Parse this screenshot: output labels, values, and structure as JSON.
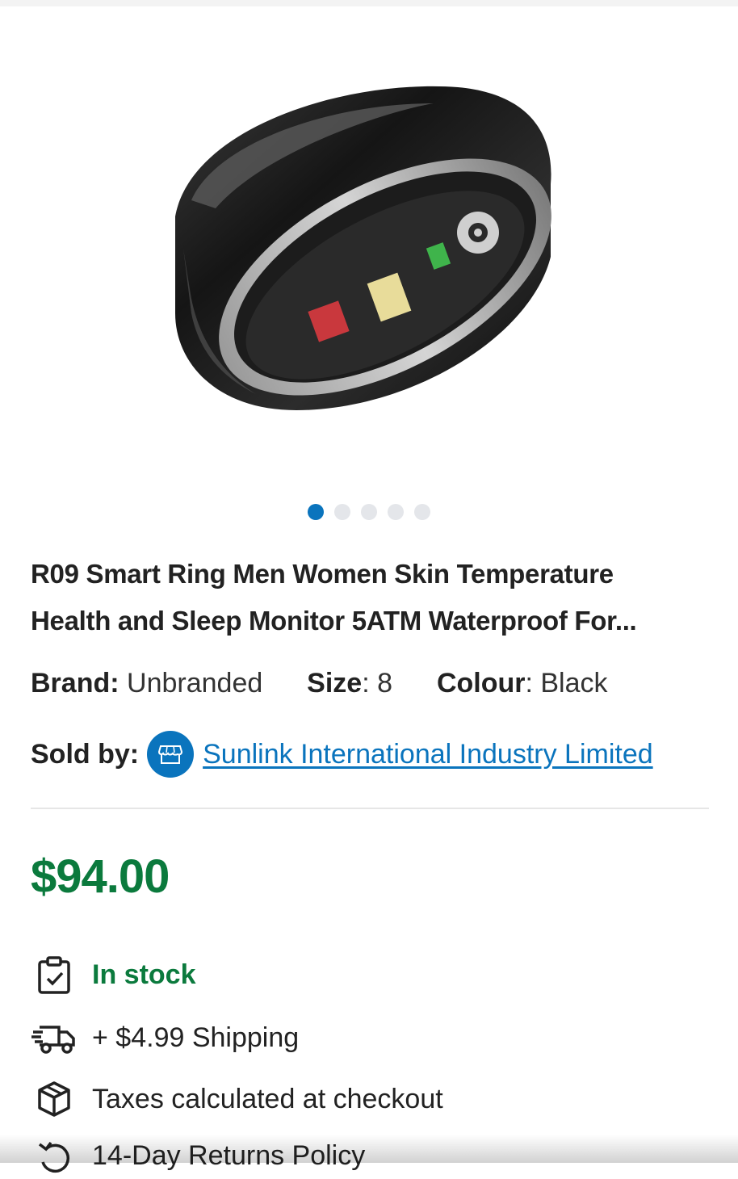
{
  "gallery": {
    "image_alt": "product-image",
    "dot_count": 5,
    "active_index": 0
  },
  "product": {
    "title_line1": "R09 Smart Ring Men Women Skin Temperature",
    "title_line2": "Health and Sleep Monitor 5ATM Waterproof For...",
    "brand_label": "Brand:",
    "brand_value": "Unbranded",
    "size_label": "Size",
    "size_value": ": 8",
    "colour_label": "Colour",
    "colour_value": ": Black",
    "sold_by_label": "Sold by:",
    "seller_name": "Sunlink International Industry Limited",
    "price": "$94.00",
    "stock_status": "In stock",
    "shipping": "+ $4.99 Shipping",
    "taxes": "Taxes calculated at checkout",
    "returns": "14-Day Returns Policy"
  },
  "colors": {
    "accent_blue": "#0a74bd",
    "price_green": "#0b7a3d"
  }
}
